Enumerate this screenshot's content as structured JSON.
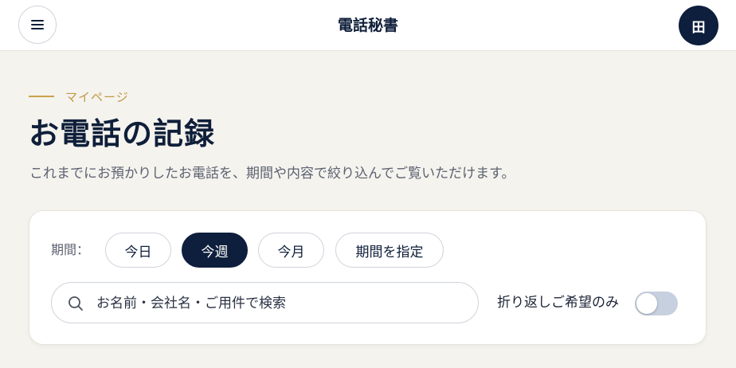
{
  "header": {
    "app_title": "電話秘書",
    "avatar_initial": "田",
    "menu_icon": "hamburger-icon"
  },
  "page": {
    "eyebrow": "マイページ",
    "title": "お電話の記録",
    "subtitle": "これまでにお預かりしたお電話を、期間や内容で絞り込んでご覧いただけます。"
  },
  "filters": {
    "period_label": "期間：",
    "periods": [
      {
        "label": "今日",
        "active": false
      },
      {
        "label": "今週",
        "active": true
      },
      {
        "label": "今月",
        "active": false
      },
      {
        "label": "期間を指定",
        "active": false
      }
    ],
    "search_placeholder": "お名前・会社名・ご用件で検索",
    "search_icon": "search-icon",
    "callback_toggle_label": "折り返しご希望のみ",
    "callback_toggle_on": false
  },
  "colors": {
    "navy": "#0e1f3d",
    "accent_gold": "#c9a24a",
    "background": "#f5f3ee",
    "toggle_off": "#c7d0df"
  }
}
